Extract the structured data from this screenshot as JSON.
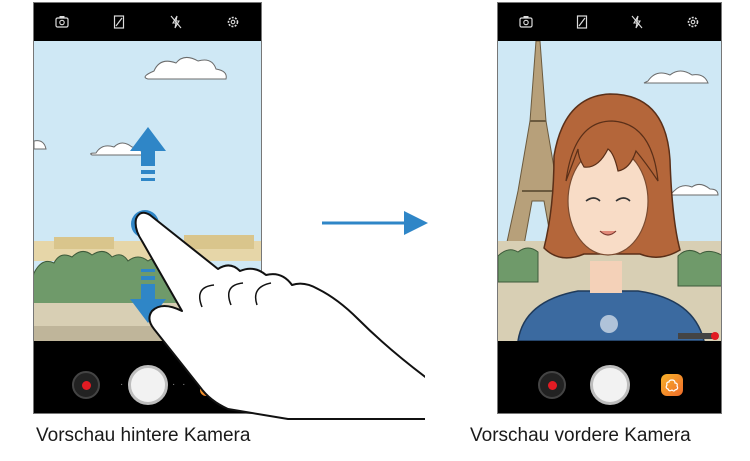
{
  "left_screen": {
    "topbar_icons": [
      "switch-camera-icon",
      "hdr-icon",
      "flash-off-icon",
      "settings-icon"
    ],
    "bottom": {
      "record": "record-video-icon",
      "shutter": "shutter-icon",
      "effects": "effects-icon"
    }
  },
  "right_screen": {
    "topbar_icons": [
      "switch-camera-icon",
      "hdr-icon",
      "flash-off-icon",
      "settings-icon"
    ],
    "bottom": {
      "record": "record-video-icon",
      "shutter": "shutter-icon",
      "effects": "effects-icon"
    }
  },
  "captions": {
    "left": "Vorschau hintere Kamera",
    "right": "Vorschau vordere Kamera"
  },
  "colors": {
    "accent_blue": "#2f86c7",
    "sky": "#cfe8f5",
    "record_red": "#e21b23"
  }
}
